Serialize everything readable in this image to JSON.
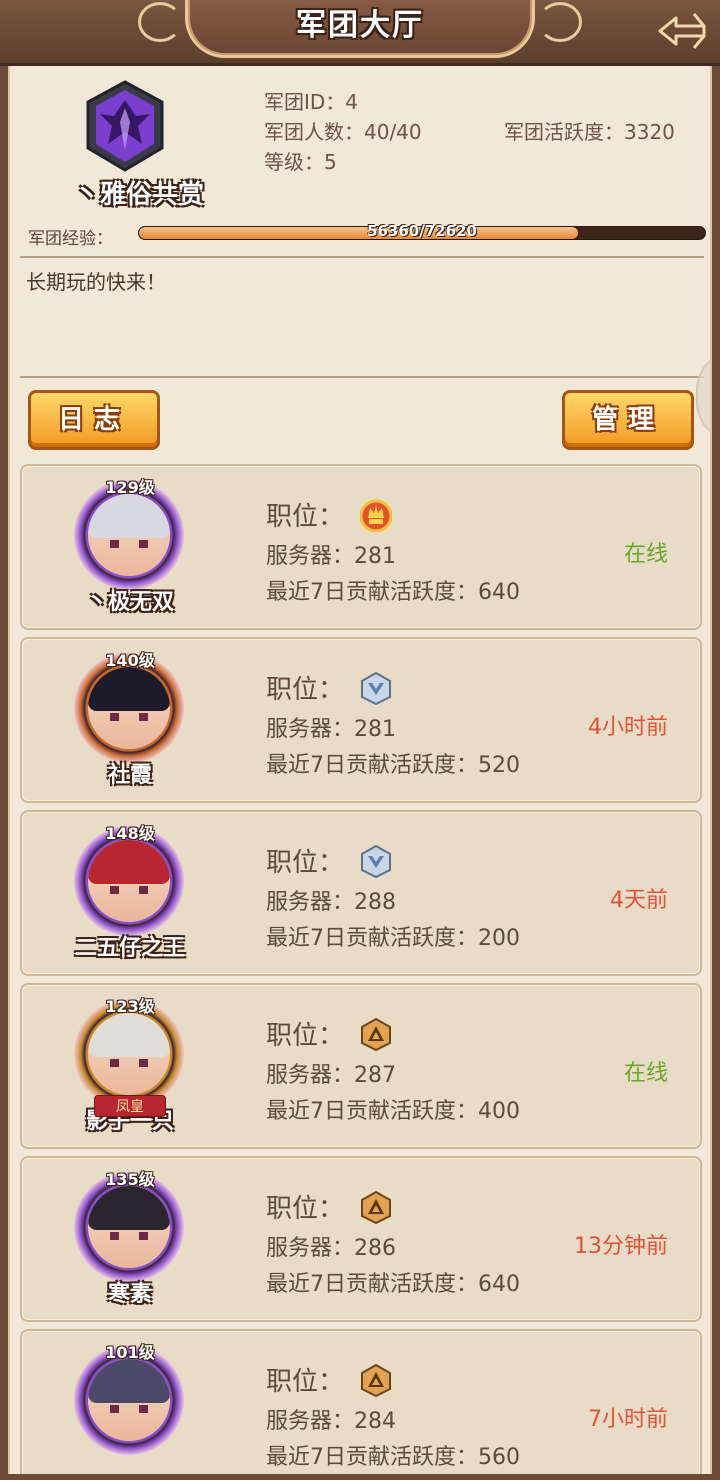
{
  "header": {
    "title": "军团大厅"
  },
  "guild": {
    "name": "丶雅俗共赏",
    "id_label": "军团ID：4",
    "members_label": "军团人数：40/40",
    "activity_label": "军团活跃度：3320",
    "level_label": "等级：5",
    "exp_label": "军团经验：",
    "exp_text": "56360/72620",
    "exp_progress": 0.776,
    "notice": "长期玩的快来！"
  },
  "buttons": {
    "log": "日志",
    "manage": "管理"
  },
  "labels": {
    "role": "职位：",
    "server_prefix": "服务器：",
    "contrib_prefix": "最近7日贡献活跃度："
  },
  "colors": {
    "online": "#6aa52a",
    "offline": "#e0523a"
  },
  "members": [
    {
      "level": "129级",
      "name": "丶极无双",
      "role_icon": "leader-crown-icon",
      "server": "服务器：281",
      "contrib": "最近7日贡献活跃度：640",
      "status": "在线",
      "online": true
    },
    {
      "level": "140级",
      "name": "社霞",
      "role_icon": "vice-leader-silver-icon",
      "server": "服务器：281",
      "contrib": "最近7日贡献活跃度：520",
      "status": "4小时前",
      "online": false
    },
    {
      "level": "148级",
      "name": "二五仔之王",
      "role_icon": "vice-leader-silver-icon",
      "server": "服务器：288",
      "contrib": "最近7日贡献活跃度：200",
      "status": "4天前",
      "online": false
    },
    {
      "level": "123级",
      "name": "影子一只",
      "role_icon": "member-bronze-icon",
      "server": "服务器：287",
      "contrib": "最近7日贡献活跃度：400",
      "status": "在线",
      "online": true,
      "badge": "凤皇"
    },
    {
      "level": "135级",
      "name": "寒素",
      "role_icon": "member-bronze-icon",
      "server": "服务器：286",
      "contrib": "最近7日贡献活跃度：640",
      "status": "13分钟前",
      "online": false
    },
    {
      "level": "101级",
      "name": "",
      "role_icon": "member-bronze-icon",
      "server": "服务器：284",
      "contrib": "最近7日贡献活跃度：560",
      "status": "7小时前",
      "online": false
    }
  ]
}
